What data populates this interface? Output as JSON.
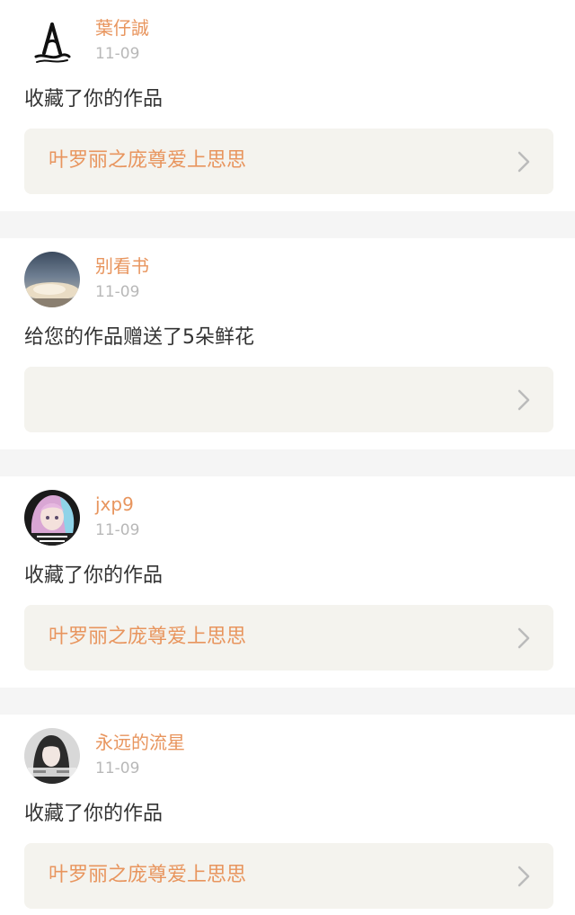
{
  "notifications": [
    {
      "username": "葉仔誠",
      "date": "11-09",
      "action": "收藏了你的作品",
      "work_title": "叶罗丽之庞尊爱上思思",
      "avatar_icon": "calligraphy-logo-avatar"
    },
    {
      "username": "别看书",
      "date": "11-09",
      "action": "给您的作品赠送了5朵鲜花",
      "work_title": "",
      "avatar_icon": "landscape-photo-avatar"
    },
    {
      "username": "jxp9",
      "date": "11-09",
      "action": "收藏了你的作品",
      "work_title": "叶罗丽之庞尊爱上思思",
      "avatar_icon": "anime-girl-avatar"
    },
    {
      "username": "永远的流星",
      "date": "11-09",
      "action": "收藏了你的作品",
      "work_title": "叶罗丽之庞尊爱上思思",
      "avatar_icon": "girl-photo-avatar"
    }
  ],
  "colors": {
    "accent": "#e8955e",
    "date": "#b8b8b8",
    "text": "#333333",
    "work_box_bg": "#f4f3ee",
    "separator": "#f5f5f5",
    "chevron": "#bbbbbb"
  },
  "icons": {
    "chevron": "chevron-right-icon"
  }
}
